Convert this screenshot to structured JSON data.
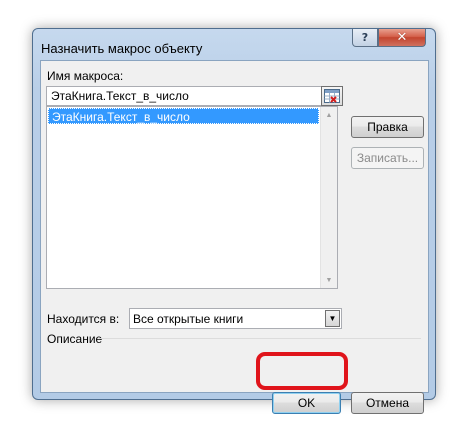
{
  "window": {
    "title": "Назначить макрос объекту"
  },
  "titlebar": {
    "help_glyph": "?",
    "close_glyph": "✕"
  },
  "form": {
    "macro_name_label": "Имя макроса:",
    "macro_name_value": "ЭтаКнига.Текст_в_число",
    "macro_list": [
      "ЭтаКнига.Текст_в_число"
    ],
    "located_in_label": "Находится в:",
    "located_in_value": "Все открытые книги",
    "description_label": "Описание"
  },
  "buttons": {
    "edit": "Правка",
    "record": "Записать...",
    "ok": "OK",
    "cancel": "Отмена"
  },
  "icons": {
    "pick_button": "range-picker-icon",
    "combo_arrow": "chevron-down-icon",
    "scroll_up": "scroll-up-icon",
    "scroll_down": "scroll-down-icon"
  },
  "colors": {
    "selection": "#3399ff",
    "highlight_annotation": "#e0141b",
    "close_button": "#c3442e"
  }
}
